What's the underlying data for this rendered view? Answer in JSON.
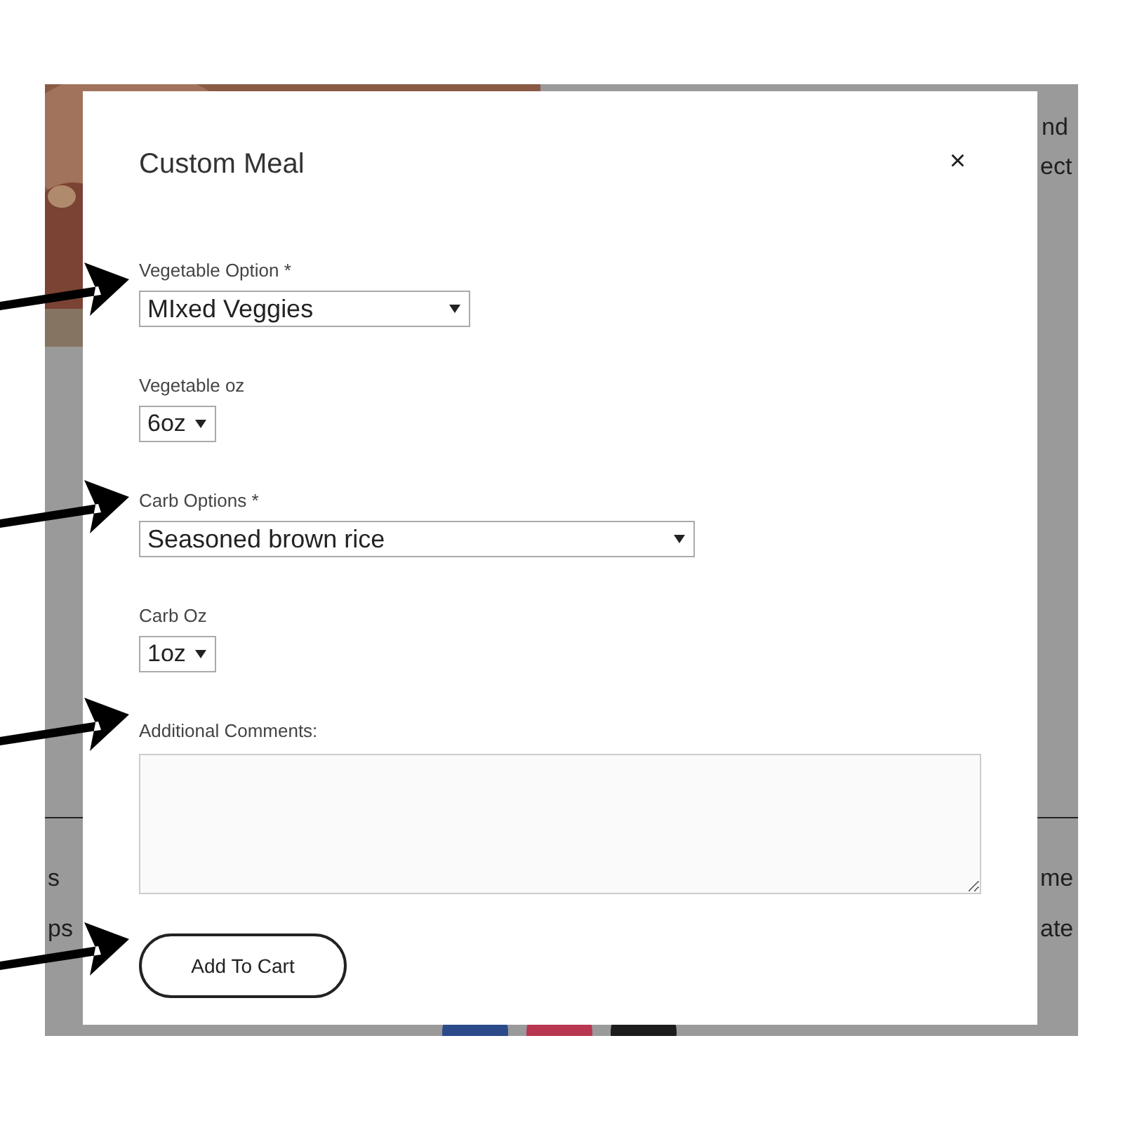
{
  "page": {
    "texts": [
      {
        "text": "nd"
      },
      {
        "text": "ect"
      },
      {
        "text": "s"
      },
      {
        "text": "ps"
      },
      {
        "text": "me"
      },
      {
        "text": "ate"
      }
    ],
    "social": [
      {
        "color": "#2b4a8a"
      },
      {
        "color": "#b8364f"
      },
      {
        "color": "#1c1c1c"
      }
    ]
  },
  "modal": {
    "title": "Custom Meal",
    "close": "×",
    "fields": [
      {
        "kind": "select",
        "label": "Vegetable Option *",
        "value": "MIxed Veggies"
      },
      {
        "kind": "select",
        "label": "Vegetable oz",
        "value": "6oz"
      },
      {
        "kind": "select",
        "label": "Carb Options *",
        "value": "Seasoned brown rice"
      },
      {
        "kind": "select",
        "label": "Carb Oz",
        "value": "1oz"
      },
      {
        "kind": "textarea",
        "label": "Additional Comments:"
      }
    ],
    "button": "Add To Cart"
  }
}
